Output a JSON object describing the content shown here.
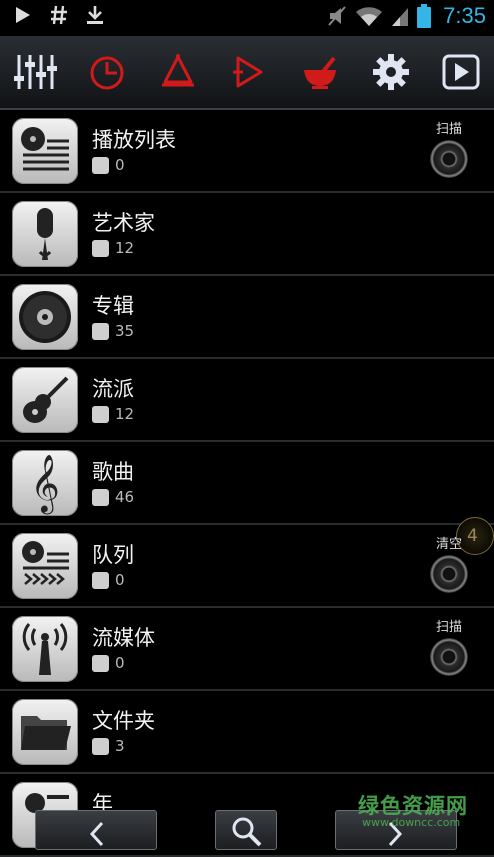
{
  "status_bar": {
    "time": "7:35",
    "icons": [
      "play-icon",
      "hash-icon",
      "download-icon",
      "mute-icon",
      "wifi-icon",
      "signal-icon",
      "battery-icon"
    ]
  },
  "toolbar": {
    "buttons": [
      "equalizer-icon",
      "sleep-timer-icon",
      "alarm-icon",
      "next-icon",
      "mortar-icon",
      "settings-icon",
      "now-playing-icon"
    ]
  },
  "library": [
    {
      "title": "播放列表",
      "count": "0",
      "icon": "playlist-icon",
      "action": "扫描"
    },
    {
      "title": "艺术家",
      "count": "12",
      "icon": "microphone-icon"
    },
    {
      "title": "专辑",
      "count": "35",
      "icon": "disc-icon"
    },
    {
      "title": "流派",
      "count": "12",
      "icon": "guitar-icon"
    },
    {
      "title": "歌曲",
      "count": "46",
      "icon": "treble-clef-icon"
    },
    {
      "title": "队列",
      "count": "0",
      "icon": "queue-icon",
      "action": "清空",
      "badge": "4"
    },
    {
      "title": "流媒体",
      "count": "0",
      "icon": "antenna-icon",
      "action": "扫描"
    },
    {
      "title": "文件夹",
      "count": "3",
      "icon": "folder-icon"
    },
    {
      "title": "年",
      "count": "",
      "icon": "year-icon"
    }
  ],
  "bottom_bar": {
    "buttons": [
      "back-icon",
      "search-icon",
      "forward-icon"
    ]
  },
  "watermark": {
    "text": "绿色资源网",
    "url": "www.downcc.com"
  },
  "colors": {
    "accent_blue": "#33b5e5",
    "toolbar_red": "#d11a1a",
    "toolbar_white": "#dfe6f2"
  }
}
